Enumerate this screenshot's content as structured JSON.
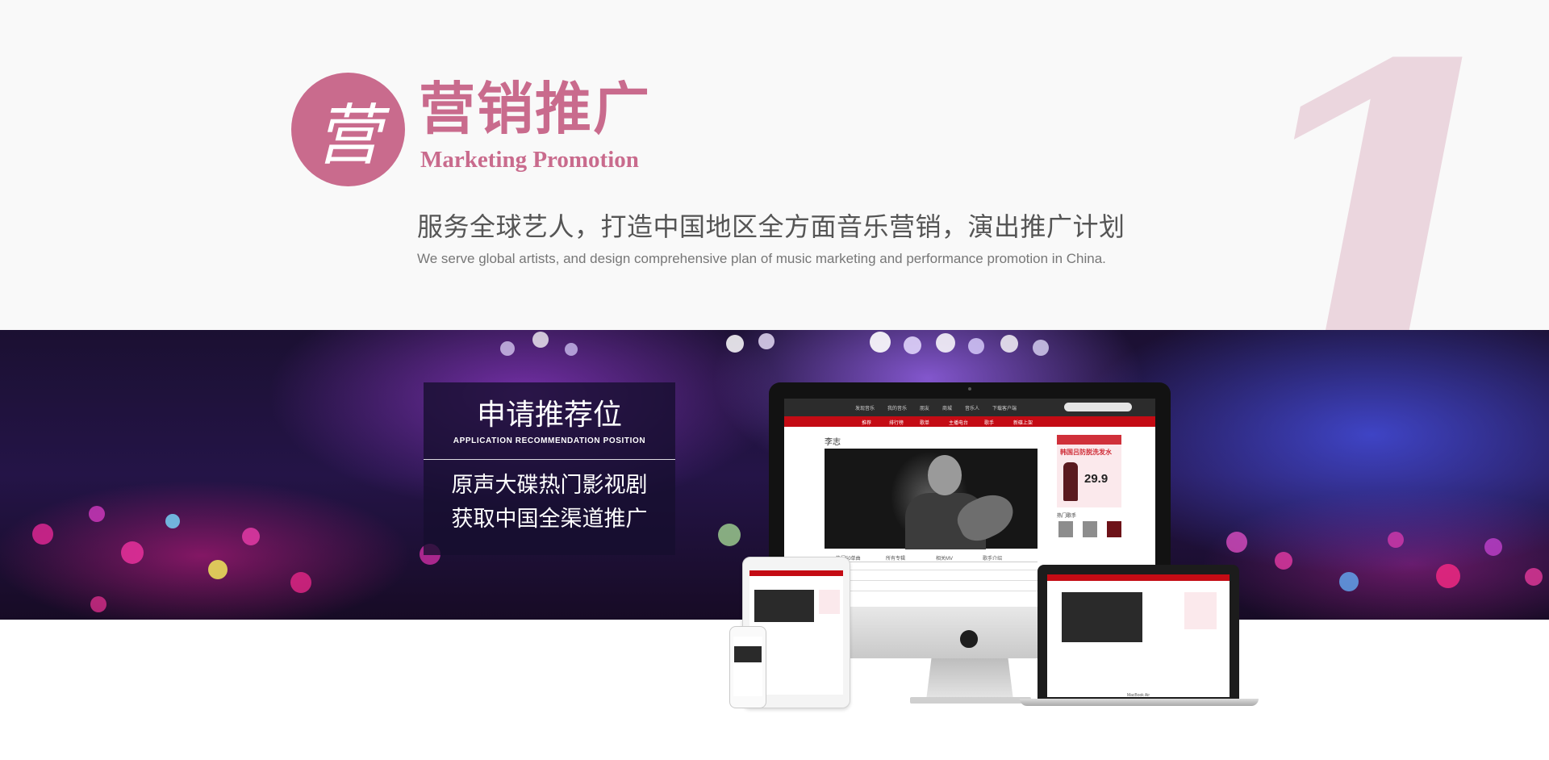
{
  "header": {
    "big_number": "1",
    "logo_glyph": "营",
    "title_cn": "营销推广",
    "title_en": "Marketing Promotion",
    "subtitle_cn": "服务全球艺人，打造中国地区全方面音乐营销，演出推广计划",
    "subtitle_en": "We serve global artists, and design comprehensive plan of music marketing and performance promotion in China."
  },
  "promo": {
    "title_cn": "申请推荐位",
    "title_en": "APPLICATION RECOMMENDATION POSITION",
    "line1": "原声大碟热门影视剧",
    "line2": "获取中国全渠道推广"
  },
  "mockup": {
    "nav": [
      "发现音乐",
      "我的音乐",
      "朋友",
      "商城",
      "音乐人",
      "下载客户端"
    ],
    "subnav": [
      "推荐",
      "排行榜",
      "歌单",
      "主播电台",
      "歌手",
      "新碟上架"
    ],
    "artist": "李志",
    "tabs": [
      "热门50单曲",
      "所有专辑",
      "相关MV",
      "歌手介绍"
    ],
    "ad_text": "韩国吕防脱洗发水",
    "ad_price": "29.9",
    "sidebar_title": "热门歌手",
    "laptop_label": "MacBook Air"
  },
  "colors": {
    "brand_pink": "#c96b8d",
    "big_number": "#ebd6de",
    "header_bg": "#f9f9f9",
    "promo_box": "#160e2e",
    "site_red": "#c40b14"
  },
  "icons": [
    "logo-circle",
    "apple-logo-icon"
  ]
}
